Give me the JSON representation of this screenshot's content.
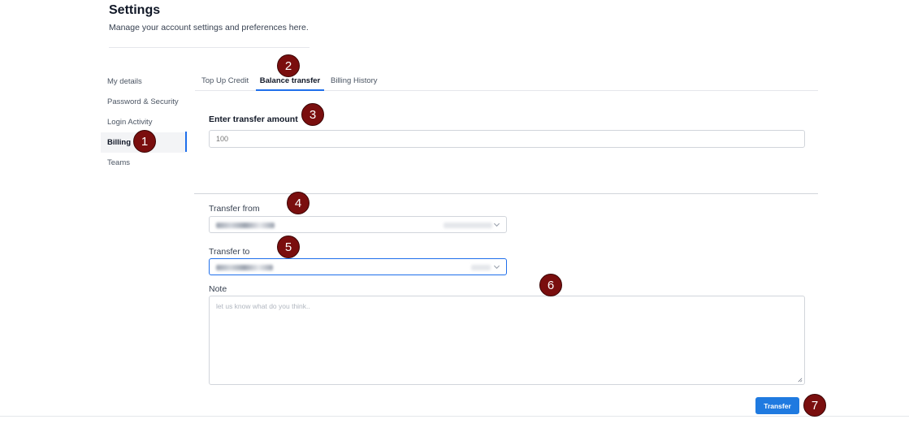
{
  "header": {
    "title": "Settings",
    "subtitle": "Manage your account settings and preferences here."
  },
  "sidebar": {
    "items": [
      {
        "label": "My details"
      },
      {
        "label": "Password & Security"
      },
      {
        "label": "Login Activity"
      },
      {
        "label": "Billing",
        "active": true
      },
      {
        "label": "Teams"
      }
    ]
  },
  "tabs": [
    {
      "label": "Top Up Credit"
    },
    {
      "label": "Balance transfer",
      "active": true
    },
    {
      "label": "Billing History"
    }
  ],
  "form": {
    "amount_label": "Enter transfer amount",
    "amount_placeholder": "100",
    "from_label": "Transfer from",
    "to_label": "Transfer to",
    "note_label": "Note",
    "note_placeholder": "let us know what do you think.."
  },
  "actions": {
    "transfer_label": "Transfer"
  },
  "markers": [
    "1",
    "2",
    "3",
    "4",
    "5",
    "6",
    "7"
  ],
  "colors": {
    "accent": "#1f7ae0",
    "marker": "#7a0e0e"
  }
}
